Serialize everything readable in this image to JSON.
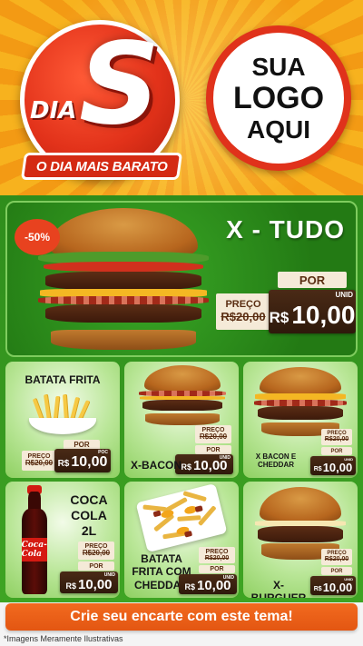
{
  "header": {
    "badge": {
      "dia": "DIA",
      "letter": "S",
      "ribbon": "O DIA MAIS BARATO"
    },
    "logo_placeholder": {
      "line1": "SUA",
      "line2": "LOGO",
      "line3": "AQUI"
    }
  },
  "hero": {
    "title": "X - TUDO",
    "discount_badge": "-50%",
    "por": "POR",
    "preco_label": "PREÇO",
    "old_price": "R$20,00",
    "currency": "R$",
    "price": "10,00",
    "unit": "UNID"
  },
  "products": [
    {
      "name": "BATATA FRITA",
      "por": "POR",
      "preco_label": "PREÇO",
      "old_price": "R$20,00",
      "currency": "R$",
      "price": "10,00",
      "unit": "POC"
    },
    {
      "name": "X-BACON",
      "por": "POR",
      "preco_label": "PREÇO",
      "old_price": "R$20,00",
      "currency": "R$",
      "price": "10,00",
      "unit": "UNID"
    },
    {
      "name": "X BACON E\nCHEDDAR",
      "por": "POR",
      "preco_label": "PREÇO",
      "old_price": "R$20,00",
      "currency": "R$",
      "price": "10,00",
      "unit": "UNID"
    },
    {
      "name": "COCA\nCOLA\n2L",
      "por": "POR",
      "preco_label": "PREÇO",
      "old_price": "R$20,00",
      "currency": "R$",
      "price": "10,00",
      "unit": "UNID"
    },
    {
      "name": "BATATA\nFRITA COM\nCHEDDAR",
      "por": "POR",
      "preco_label": "PREÇO",
      "old_price": "R$20,00",
      "currency": "R$",
      "price": "10,00",
      "unit": "UNID"
    },
    {
      "name": "X-BURGUER",
      "por": "POR",
      "preco_label": "PREÇO",
      "old_price": "R$20,00",
      "currency": "R$",
      "price": "10,00",
      "unit": "UNID"
    }
  ],
  "cta": {
    "label": "Crie seu encarte com este tema!"
  },
  "disclaimer": "*Imagens Meramente Ilustrativas",
  "colors": {
    "green": "#3ea423",
    "orange": "#f39a14",
    "red": "#e0321b",
    "brown": "#3c200e",
    "cream": "#f5ead8",
    "cta": "#ec5f17"
  }
}
